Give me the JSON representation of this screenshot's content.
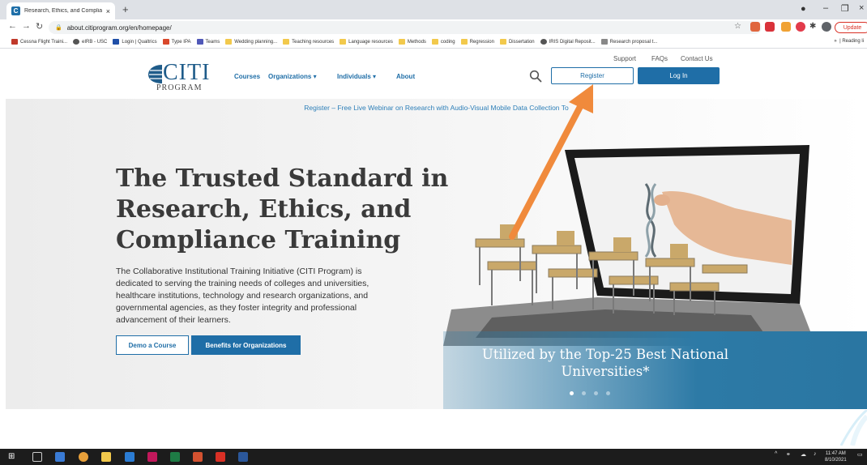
{
  "browser": {
    "tab_title": "Research, Ethics, and Compliance",
    "tab_close": "×",
    "new_tab": "+",
    "url": "about.citiprogram.org/en/homepage/",
    "update_label": "Update",
    "reading_list": "Reading li",
    "bookmarks_overflow": "»",
    "bookmarks": [
      "Cessna Flight Traini...",
      "eIRB - USC",
      "Login | Qualtrics",
      "Type IPA",
      "Teams",
      "Wedding planning...",
      "Teaching resources",
      "Language resources",
      "Methods",
      "coding",
      "Regression",
      "Dissertation",
      "IRIS Digital Reposit...",
      "Research proposal t..."
    ]
  },
  "header": {
    "logo_main": "CITI",
    "logo_sub": "PROGRAM",
    "util_links": [
      "Support",
      "FAQs",
      "Contact Us"
    ],
    "nav": {
      "courses": "Courses",
      "organizations": "Organizations ▾",
      "individuals": "Individuals ▾",
      "about": "About"
    },
    "register": "Register",
    "login": "Log In"
  },
  "hero": {
    "banner": "Register – Free Live Webinar on Research with Audio-Visual Mobile Data Collection To",
    "title": "The Trusted Standard in Research, Ethics, and Compliance Training",
    "description": "The Collaborative Institutional Training Initiative (CITI Program) is dedicated to serving the training needs of colleges and universities, healthcare institutions, technology and research organizations, and governmental agencies, as they foster integrity and professional advancement of their learners.",
    "demo_button": "Demo a Course",
    "benefits_button": "Benefits for Organizations",
    "slide_caption": "Utilized by the Top-25 Best National Universities*",
    "slide_count": 4,
    "active_slide": 1
  },
  "taskbar": {
    "time": "11:47 AM",
    "date": "8/10/2021"
  },
  "colors": {
    "brand_blue": "#1f6ea7",
    "arrow_orange": "#f08a3c",
    "overlay_blue": "#2d7aa6"
  }
}
